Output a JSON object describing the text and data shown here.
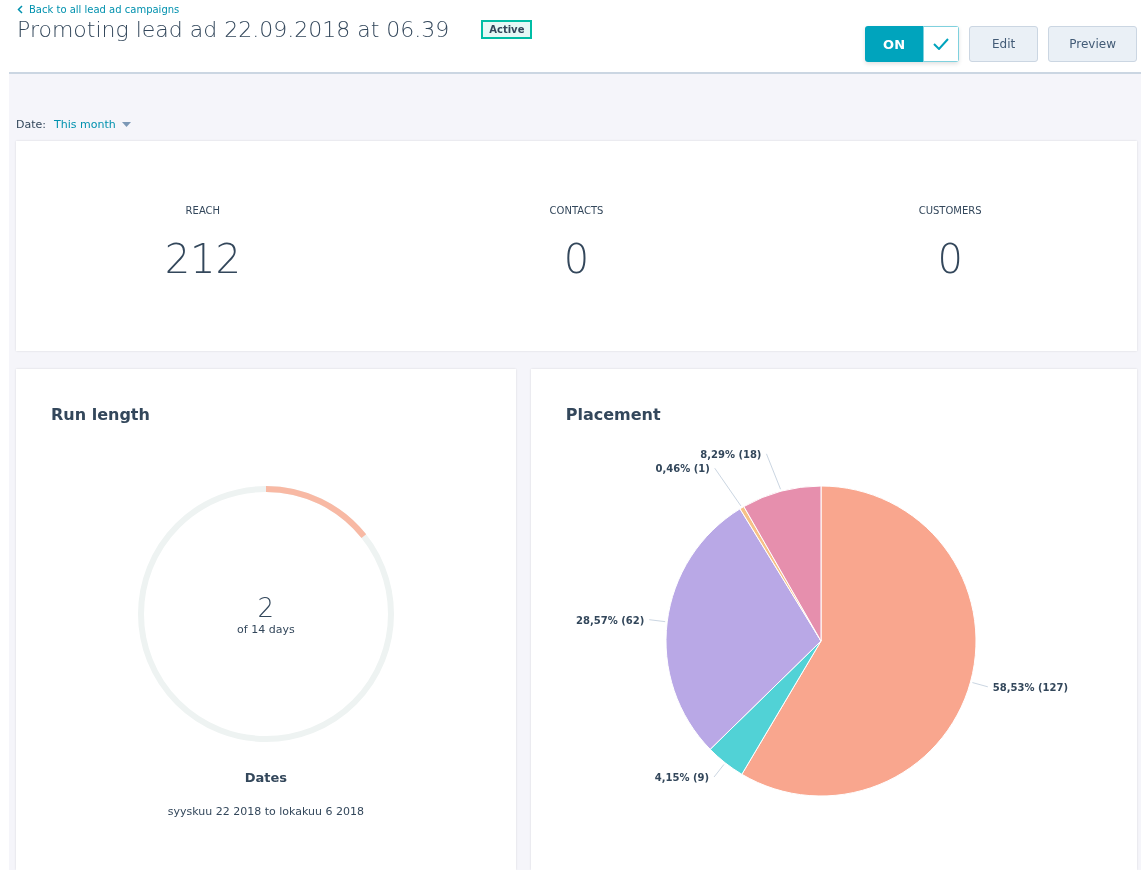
{
  "back_link": "Back to all lead ad campaigns",
  "title": "Promoting lead ad 22.09.2018 at 06.39",
  "status_badge": "Active",
  "toggle": {
    "label": "ON",
    "on": true
  },
  "buttons": [
    "Edit",
    "Preview"
  ],
  "date_filter": {
    "label": "Date:",
    "value": "This month"
  },
  "stats": [
    {
      "label": "REACH",
      "value": "212"
    },
    {
      "label": "CONTACTS",
      "value": "0"
    },
    {
      "label": "CUSTOMERS",
      "value": "0"
    }
  ],
  "run_length": {
    "title": "Run length",
    "days": "2",
    "of_text": "of 14 days",
    "dates_title": "Dates",
    "dates": "syyskuu 22 2018 to lokakuu 6 2018"
  },
  "placement": {
    "title": "Placement",
    "chart_data": {
      "type": "pie",
      "values": [
        58.53,
        4.15,
        28.57,
        0.46,
        8.29
      ],
      "colors": [
        "#f9a68e",
        "#51d2d6",
        "#b9a8e6",
        "#f6c187",
        "#e68fad"
      ],
      "value_labels": [
        "58,53% (127)",
        "4,15% (9)",
        "28,57% (62)",
        "0,46% (1)",
        "8,29% (18)"
      ]
    }
  }
}
